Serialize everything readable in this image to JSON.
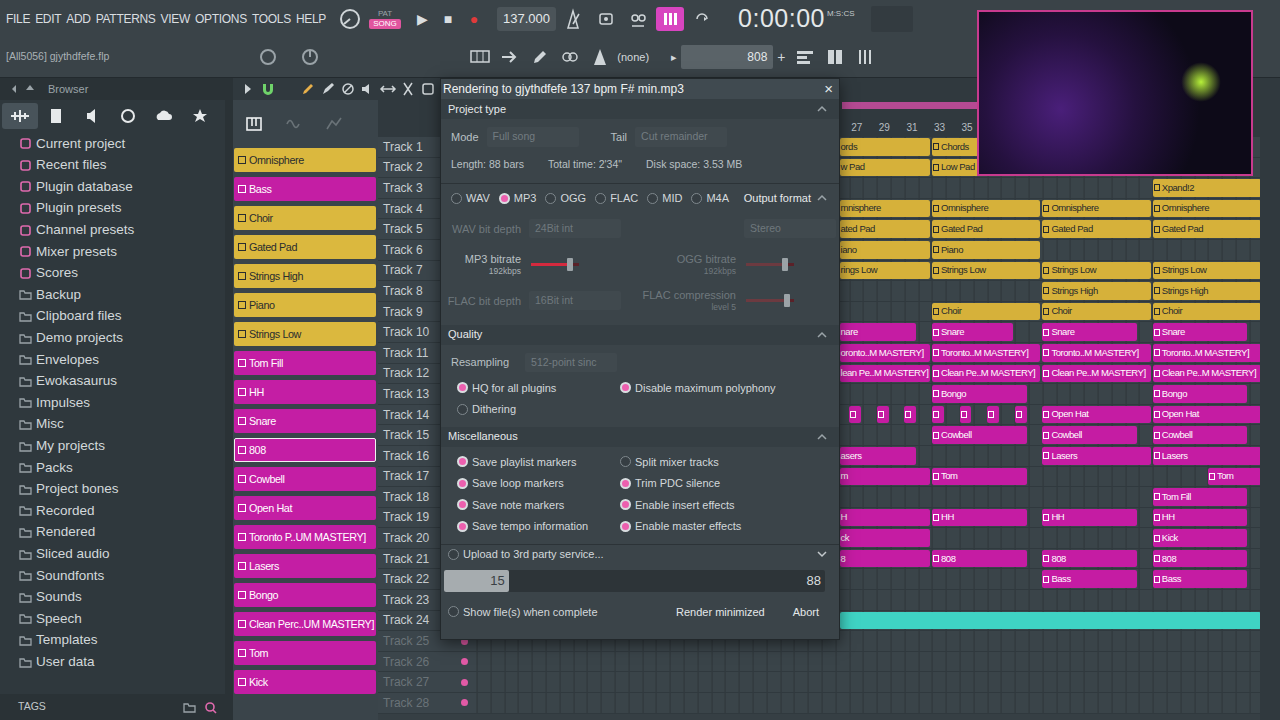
{
  "menu": [
    "FILE",
    "EDIT",
    "ADD",
    "PATTERNS",
    "VIEW",
    "OPTIONS",
    "TOOLS",
    "HELP"
  ],
  "transport": {
    "pat": "PAT",
    "song": "SONG",
    "song_selected": true,
    "play": "▶",
    "stop": "■",
    "record": "●",
    "tempo": "137.000",
    "toggles": [
      {
        "on": false
      },
      {
        "on": false
      },
      {
        "on": false
      },
      {
        "on": true
      },
      {
        "on": false
      }
    ],
    "time": "0:00:00",
    "time_label": "M:S:CS"
  },
  "project": {
    "file": "[All5056] gjythdfefe.flp",
    "snap": "(none)",
    "step": "▸",
    "pattern": "808",
    "add": "+"
  },
  "browser": {
    "title": "Browser",
    "tabs": [
      {
        "selected": true
      },
      {
        "selected": false
      },
      {
        "selected": false
      },
      {
        "selected": false
      },
      {
        "selected": false
      },
      {
        "selected": false
      }
    ],
    "items": [
      {
        "label": "Current project",
        "kind": "category"
      },
      {
        "label": "Recent files",
        "kind": "category"
      },
      {
        "label": "Plugin database",
        "kind": "category"
      },
      {
        "label": "Plugin presets",
        "kind": "category"
      },
      {
        "label": "Channel presets",
        "kind": "category"
      },
      {
        "label": "Mixer presets",
        "kind": "category"
      },
      {
        "label": "Scores",
        "kind": "category"
      },
      {
        "label": "Backup",
        "kind": "folder"
      },
      {
        "label": "Clipboard files",
        "kind": "folder"
      },
      {
        "label": "Demo projects",
        "kind": "folder"
      },
      {
        "label": "Envelopes",
        "kind": "folder"
      },
      {
        "label": "Ewokasaurus",
        "kind": "folder"
      },
      {
        "label": "Impulses",
        "kind": "folder"
      },
      {
        "label": "Misc",
        "kind": "folder"
      },
      {
        "label": "My projects",
        "kind": "folder"
      },
      {
        "label": "Packs",
        "kind": "folder"
      },
      {
        "label": "Project bones",
        "kind": "folder"
      },
      {
        "label": "Recorded",
        "kind": "folder"
      },
      {
        "label": "Rendered",
        "kind": "folder"
      },
      {
        "label": "Sliced audio",
        "kind": "folder"
      },
      {
        "label": "Soundfonts",
        "kind": "folder"
      },
      {
        "label": "Sounds",
        "kind": "folder"
      },
      {
        "label": "Speech",
        "kind": "folder"
      },
      {
        "label": "Templates",
        "kind": "folder"
      },
      {
        "label": "User data",
        "kind": "folder"
      }
    ],
    "footer": "TAGS"
  },
  "patterns": [
    {
      "name": "Omnisphere",
      "color": "#dbb83e",
      "selected": false
    },
    {
      "name": "Bass",
      "color": "#c41ea4",
      "selected": false
    },
    {
      "name": "Choir",
      "color": "#dbb83e",
      "selected": false
    },
    {
      "name": "Gated Pad",
      "color": "#dbb83e",
      "selected": false
    },
    {
      "name": "Strings High",
      "color": "#dbb83e",
      "selected": false
    },
    {
      "name": "Piano",
      "color": "#dbb83e",
      "selected": false
    },
    {
      "name": "Strings Low",
      "color": "#dbb83e",
      "selected": false
    },
    {
      "name": "Tom Fill",
      "color": "#c41ea4",
      "selected": false
    },
    {
      "name": "HH",
      "color": "#c41ea4",
      "selected": false
    },
    {
      "name": "Snare",
      "color": "#c41ea4",
      "selected": false
    },
    {
      "name": "808",
      "color": "#c41ea4",
      "selected": true
    },
    {
      "name": "Cowbell",
      "color": "#c41ea4",
      "selected": false
    },
    {
      "name": "Open Hat",
      "color": "#c41ea4",
      "selected": false
    },
    {
      "name": "Toronto P..UM MASTERY]",
      "color": "#c41ea4",
      "selected": false
    },
    {
      "name": "Lasers",
      "color": "#c41ea4",
      "selected": false
    },
    {
      "name": "Bongo",
      "color": "#c41ea4",
      "selected": false
    },
    {
      "name": "Clean Perc..UM MASTERY]",
      "color": "#c41ea4",
      "selected": false
    },
    {
      "name": "Tom",
      "color": "#c41ea4",
      "selected": false
    },
    {
      "name": "Kick",
      "color": "#c41ea4",
      "selected": false
    }
  ],
  "playlist": {
    "ruler": [
      {
        "label": "27",
        "bar": 27
      },
      {
        "label": "29",
        "bar": 29
      },
      {
        "label": "31",
        "bar": 31
      },
      {
        "label": "33",
        "bar": 33
      },
      {
        "label": "35",
        "bar": 35
      }
    ],
    "tracks": [
      {
        "label": "Track 1",
        "empty": false
      },
      {
        "label": "Track 2",
        "empty": false
      },
      {
        "label": "Track 3",
        "empty": false
      },
      {
        "label": "Track 4",
        "empty": false
      },
      {
        "label": "Track 5",
        "empty": false
      },
      {
        "label": "Track 6",
        "empty": false
      },
      {
        "label": "Track 7",
        "empty": false
      },
      {
        "label": "Track 8",
        "empty": false
      },
      {
        "label": "Track 9",
        "empty": false
      },
      {
        "label": "Track 10",
        "empty": false
      },
      {
        "label": "Track 11",
        "empty": false
      },
      {
        "label": "Track 12",
        "empty": false
      },
      {
        "label": "Track 13",
        "empty": false
      },
      {
        "label": "Track 14",
        "empty": false
      },
      {
        "label": "Track 15",
        "empty": false
      },
      {
        "label": "Track 16",
        "empty": false
      },
      {
        "label": "Track 17",
        "empty": false
      },
      {
        "label": "Track 18",
        "empty": false
      },
      {
        "label": "Track 19",
        "empty": false
      },
      {
        "label": "Track 20",
        "empty": false
      },
      {
        "label": "Track 21",
        "empty": false
      },
      {
        "label": "Track 22",
        "empty": false
      },
      {
        "label": "Track 23",
        "empty": false
      },
      {
        "label": "Track 24",
        "empty": false
      },
      {
        "label": "Track 25",
        "empty": true
      },
      {
        "label": "Track 26",
        "empty": true
      },
      {
        "label": "Track 27",
        "empty": true
      },
      {
        "label": "Track 28",
        "empty": true
      }
    ],
    "clips": [
      {
        "track": 1,
        "bar": 26.3,
        "bars": 6.7,
        "name": "ords",
        "color": "#d6b13a"
      },
      {
        "track": 1,
        "bar": 33,
        "bars": 8,
        "name": "Chords",
        "color": "#d6b13a"
      },
      {
        "track": 2,
        "bar": 26.3,
        "bars": 6.7,
        "name": "w Pad",
        "color": "#d6b13a"
      },
      {
        "track": 2,
        "bar": 33,
        "bars": 8,
        "name": "Low Pad",
        "color": "#d6b13a"
      },
      {
        "track": 3,
        "bar": 49,
        "bars": 8,
        "name": "Xpand!2",
        "color": "#d6b13a"
      },
      {
        "track": 4,
        "bar": 26.3,
        "bars": 6.7,
        "name": "mnisphere",
        "color": "#d6b13a"
      },
      {
        "track": 4,
        "bar": 33,
        "bars": 8,
        "name": "Omnisphere",
        "color": "#d6b13a"
      },
      {
        "track": 4,
        "bar": 41,
        "bars": 8,
        "name": "Omnisphere",
        "color": "#d6b13a"
      },
      {
        "track": 4,
        "bar": 49,
        "bars": 8,
        "name": "Omnisphere",
        "color": "#d6b13a"
      },
      {
        "track": 5,
        "bar": 26.3,
        "bars": 6.7,
        "name": "ated Pad",
        "color": "#d6b13a"
      },
      {
        "track": 5,
        "bar": 33,
        "bars": 8,
        "name": "Gated Pad",
        "color": "#d6b13a"
      },
      {
        "track": 5,
        "bar": 41,
        "bars": 8,
        "name": "Gated Pad",
        "color": "#d6b13a"
      },
      {
        "track": 5,
        "bar": 49,
        "bars": 8,
        "name": "Gated Pad",
        "color": "#d6b13a"
      },
      {
        "track": 6,
        "bar": 26.3,
        "bars": 6.7,
        "name": "iano",
        "color": "#d6b13a"
      },
      {
        "track": 6,
        "bar": 33,
        "bars": 8,
        "name": "Piano",
        "color": "#d6b13a"
      },
      {
        "track": 7,
        "bar": 26.3,
        "bars": 6.7,
        "name": "rings Low",
        "color": "#d6b13a"
      },
      {
        "track": 7,
        "bar": 33,
        "bars": 8,
        "name": "Strings Low",
        "color": "#d6b13a"
      },
      {
        "track": 7,
        "bar": 41,
        "bars": 8,
        "name": "Strings Low",
        "color": "#d6b13a"
      },
      {
        "track": 7,
        "bar": 49,
        "bars": 8,
        "name": "Strings Low",
        "color": "#d6b13a"
      },
      {
        "track": 8,
        "bar": 41,
        "bars": 8,
        "name": "Strings High",
        "color": "#d6b13a"
      },
      {
        "track": 8,
        "bar": 49,
        "bars": 8,
        "name": "Strings High",
        "color": "#d6b13a"
      },
      {
        "track": 9,
        "bar": 33,
        "bars": 8,
        "name": "Choir",
        "color": "#d6b13a"
      },
      {
        "track": 9,
        "bar": 41,
        "bars": 8,
        "name": "Choir",
        "color": "#d6b13a"
      },
      {
        "track": 9,
        "bar": 49,
        "bars": 8,
        "name": "Choir",
        "color": "#d6b13a"
      },
      {
        "track": 10,
        "bar": 26.3,
        "bars": 5.7,
        "name": "nare",
        "color": "#c51ca3"
      },
      {
        "track": 10,
        "bar": 33,
        "bars": 6,
        "name": "Snare",
        "color": "#c51ca3"
      },
      {
        "track": 10,
        "bar": 41,
        "bars": 7,
        "name": "Snare",
        "color": "#c51ca3"
      },
      {
        "track": 10,
        "bar": 49,
        "bars": 7,
        "name": "Snare",
        "color": "#c51ca3"
      },
      {
        "track": 11,
        "bar": 26.3,
        "bars": 6.7,
        "name": "oronto..M MASTERY]",
        "color": "#c51ca3"
      },
      {
        "track": 11,
        "bar": 33,
        "bars": 8,
        "name": "Toronto..M MASTERY]",
        "color": "#c51ca3"
      },
      {
        "track": 11,
        "bar": 41,
        "bars": 8,
        "name": "Toronto..M MASTERY]",
        "color": "#c51ca3"
      },
      {
        "track": 11,
        "bar": 49,
        "bars": 8,
        "name": "Toronto..M MASTERY]",
        "color": "#c51ca3"
      },
      {
        "track": 12,
        "bar": 26.3,
        "bars": 6.7,
        "name": "lean Pe..M MASTERY]",
        "color": "#c51ca3"
      },
      {
        "track": 12,
        "bar": 33,
        "bars": 8,
        "name": "Clean Pe..M MASTERY]",
        "color": "#c51ca3"
      },
      {
        "track": 12,
        "bar": 41,
        "bars": 8,
        "name": "Clean Pe..M MASTERY]",
        "color": "#c51ca3"
      },
      {
        "track": 12,
        "bar": 49,
        "bars": 8,
        "name": "Clean Pe..M MASTERY]",
        "color": "#c51ca3"
      },
      {
        "track": 13,
        "bar": 33,
        "bars": 7,
        "name": "Bongo",
        "color": "#c51ca3"
      },
      {
        "track": 13,
        "bar": 49,
        "bars": 7,
        "name": "Bongo",
        "color": "#c51ca3"
      },
      {
        "track": 14,
        "bar": 27,
        "bars": 1,
        "color": "#c51ca3"
      },
      {
        "track": 14,
        "bar": 29,
        "bars": 1,
        "color": "#c51ca3"
      },
      {
        "track": 14,
        "bar": 31,
        "bars": 1,
        "color": "#c51ca3"
      },
      {
        "track": 14,
        "bar": 33,
        "bars": 1,
        "color": "#c51ca3"
      },
      {
        "track": 14,
        "bar": 35,
        "bars": 1,
        "color": "#c51ca3"
      },
      {
        "track": 14,
        "bar": 37,
        "bars": 1,
        "color": "#c51ca3"
      },
      {
        "track": 14,
        "bar": 39,
        "bars": 1,
        "color": "#c51ca3"
      },
      {
        "track": 14,
        "bar": 41,
        "bars": 8,
        "name": "Open Hat",
        "color": "#c51ca3"
      },
      {
        "track": 14,
        "bar": 49,
        "bars": 8,
        "name": "Open Hat",
        "color": "#c51ca3"
      },
      {
        "track": 15,
        "bar": 33,
        "bars": 7,
        "name": "Cowbell",
        "color": "#c51ca3"
      },
      {
        "track": 15,
        "bar": 41,
        "bars": 7,
        "name": "Cowbell",
        "color": "#c51ca3"
      },
      {
        "track": 15,
        "bar": 49,
        "bars": 7,
        "name": "Cowbell",
        "color": "#c51ca3"
      },
      {
        "track": 16,
        "bar": 26.3,
        "bars": 5.7,
        "name": "asers",
        "color": "#c51ca3"
      },
      {
        "track": 16,
        "bar": 41,
        "bars": 8,
        "name": "Lasers",
        "color": "#c51ca3"
      },
      {
        "track": 16,
        "bar": 49,
        "bars": 8,
        "name": "Lasers",
        "color": "#c51ca3"
      },
      {
        "track": 17,
        "bar": 26.3,
        "bars": 6.7,
        "name": "m",
        "color": "#c51ca3"
      },
      {
        "track": 17,
        "bar": 33,
        "bars": 7,
        "name": "Tom",
        "color": "#c51ca3"
      },
      {
        "track": 17,
        "bar": 53,
        "bars": 4,
        "name": "Tom",
        "color": "#c51ca3"
      },
      {
        "track": 18,
        "bar": 49,
        "bars": 7,
        "name": "Tom Fill",
        "color": "#c51ca3"
      },
      {
        "track": 19,
        "bar": 26.3,
        "bars": 6.7,
        "name": "H",
        "color": "#c51ca3"
      },
      {
        "track": 19,
        "bar": 33,
        "bars": 7,
        "name": "HH",
        "color": "#c51ca3"
      },
      {
        "track": 19,
        "bar": 41,
        "bars": 7,
        "name": "HH",
        "color": "#c51ca3"
      },
      {
        "track": 19,
        "bar": 49,
        "bars": 7,
        "name": "HH",
        "color": "#c51ca3"
      },
      {
        "track": 20,
        "bar": 26.3,
        "bars": 6.7,
        "name": "ck",
        "color": "#c51ca3"
      },
      {
        "track": 20,
        "bar": 49,
        "bars": 7,
        "name": "Kick",
        "color": "#c51ca3"
      },
      {
        "track": 21,
        "bar": 26.3,
        "bars": 6.7,
        "name": "8",
        "color": "#c51ca3"
      },
      {
        "track": 21,
        "bar": 33,
        "bars": 7,
        "name": "808",
        "color": "#c51ca3"
      },
      {
        "track": 21,
        "bar": 41,
        "bars": 7,
        "name": "808",
        "color": "#c51ca3"
      },
      {
        "track": 21,
        "bar": 49,
        "bars": 7,
        "name": "808",
        "color": "#c51ca3"
      },
      {
        "track": 22,
        "bar": 41,
        "bars": 7,
        "name": "Bass",
        "color": "#c51ca3"
      },
      {
        "track": 22,
        "bar": 49,
        "bars": 7,
        "name": "Bass",
        "color": "#c51ca3"
      },
      {
        "track": 24,
        "bar": 26.3,
        "bars": 30.7,
        "color": "#3fd3c4"
      }
    ]
  },
  "dialog": {
    "title": "Rendering to gjythdfefe 137 bpm F# min.mp3",
    "close": "×",
    "project_type": {
      "heading": "Project type",
      "mode_label": "Mode",
      "mode": "Full song",
      "tail_label": "Tail",
      "tail": "Cut remainder",
      "length": "Length: 88 bars",
      "total": "Total time: 2'34\"",
      "disk": "Disk space: 3.53 MB"
    },
    "formats": [
      {
        "label": "WAV",
        "selected": false
      },
      {
        "label": "MP3",
        "selected": true
      },
      {
        "label": "OGG",
        "selected": false
      },
      {
        "label": "FLAC",
        "selected": false
      },
      {
        "label": "MID",
        "selected": false
      },
      {
        "label": "M4A",
        "selected": false
      }
    ],
    "format_heading": "Output format",
    "format_settings": [
      {
        "kind": "select",
        "label": "WAV bit depth",
        "value": "24Bit int",
        "disabled": true
      },
      {
        "kind": "select",
        "value": "Stereo",
        "disabled": true
      },
      {
        "kind": "slider",
        "label": "MP3 bitrate",
        "sub": "192kbps",
        "level": 0.82,
        "disabled": false
      },
      {
        "kind": "slider",
        "label": "OGG bitrate",
        "sub": "192kbps",
        "level": 0.82,
        "disabled": true
      },
      {
        "kind": "select",
        "label": "FLAC bit depth",
        "value": "16Bit int",
        "disabled": true
      },
      {
        "kind": "slider",
        "label": "FLAC compression",
        "sub": "level 5",
        "level": 0.85,
        "disabled": true
      }
    ],
    "quality": {
      "heading": "Quality",
      "resampling_label": "Resampling",
      "resampling": "512-point sinc",
      "options": [
        {
          "label": "HQ for all plugins",
          "checked": true
        },
        {
          "label": "Disable maximum polyphony",
          "checked": true
        },
        {
          "label": "Dithering",
          "checked": false
        }
      ]
    },
    "misc": {
      "heading": "Miscellaneous",
      "options": [
        {
          "label": "Save playlist markers",
          "checked": true
        },
        {
          "label": "Split mixer tracks",
          "checked": false
        },
        {
          "label": "Save loop markers",
          "checked": true
        },
        {
          "label": "Trim PDC silence",
          "checked": true
        },
        {
          "label": "Save note markers",
          "checked": true
        },
        {
          "label": "Enable insert effects",
          "checked": true
        },
        {
          "label": "Save tempo information",
          "checked": true
        },
        {
          "label": "Enable master effects",
          "checked": true
        }
      ]
    },
    "upload": {
      "label": "Upload to 3rd party service...",
      "checked": false
    },
    "progress": {
      "value": "15",
      "total": "88",
      "level": 0.17
    },
    "show_files": {
      "label": "Show file(s) when complete",
      "checked": false
    },
    "buttons": [
      "Render minimized",
      "Abort"
    ]
  }
}
